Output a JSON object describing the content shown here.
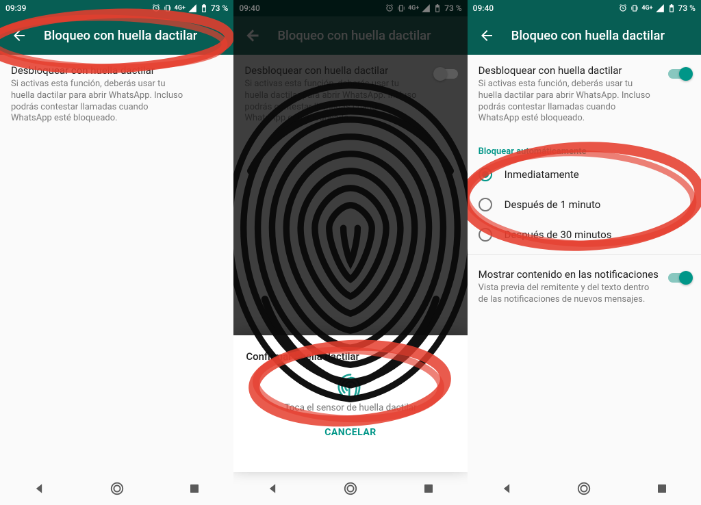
{
  "status": {
    "time1": "09:39",
    "time2": "09:40",
    "time3": "09:40",
    "net": "4G+",
    "battery": "73 %"
  },
  "appbar": {
    "title": "Bloqueo con huella dactilar"
  },
  "unlock": {
    "title": "Desbloquear con huella dactilar",
    "desc": "Si activas esta función, deberás usar tu huella dactilar para abrir WhatsApp. Incluso podrás contestar llamadas cuando WhatsApp esté bloqueado."
  },
  "autoLock": {
    "header": "Bloquear automáticamente",
    "opt1": "Inmediatamente",
    "opt2": "Después de 1 minuto",
    "opt3": "Después de 30 minutos"
  },
  "notify": {
    "title": "Mostrar contenido en las notificaciones",
    "desc": "Vista previa del remitente y del texto dentro de las notificaciones de nuevos mensajes."
  },
  "dialog": {
    "title": "Confirmar huella dactilar",
    "hint": "Toca el sensor de huella dactilar",
    "cancel": "CANCELAR"
  }
}
